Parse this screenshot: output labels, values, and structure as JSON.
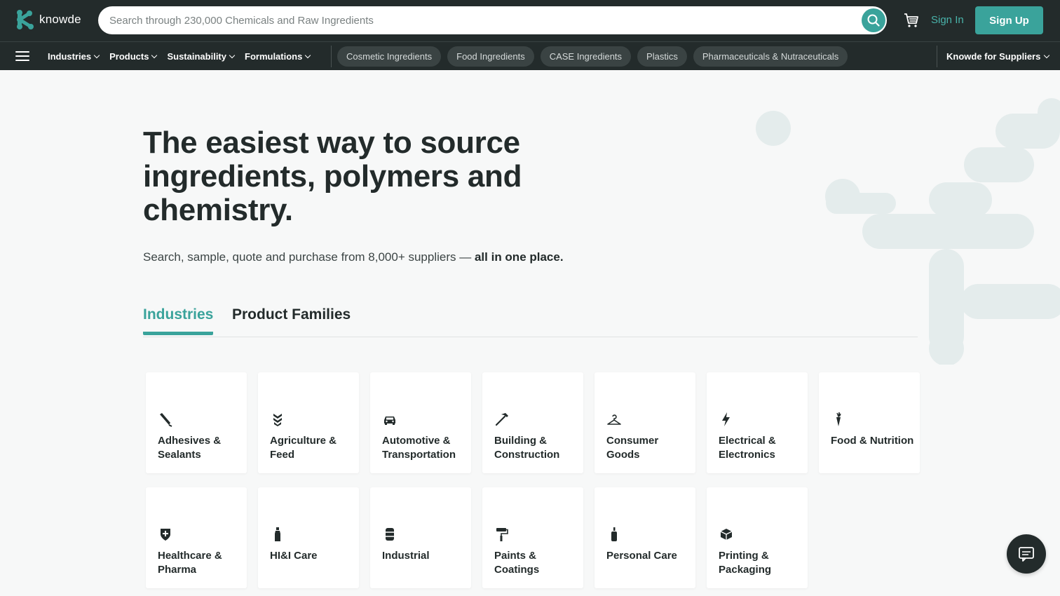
{
  "header": {
    "logo_text": "knowde",
    "search_placeholder": "Search through 230,000 Chemicals and Raw Ingredients",
    "sign_in": "Sign In",
    "sign_up": "Sign Up",
    "brand_color": "#3aa39b",
    "dark_color": "#232b2b"
  },
  "nav": {
    "menu": [
      "Industries",
      "Products",
      "Sustainability",
      "Formulations"
    ],
    "chips": [
      "Cosmetic Ingredients",
      "Food Ingredients",
      "CASE Ingredients",
      "Plastics",
      "Pharmaceuticals & Nutraceuticals"
    ],
    "suppliers": "Knowde for Suppliers"
  },
  "hero": {
    "title": "The easiest way to source ingredients, polymers and chemistry.",
    "subtitle": "Search, sample, quote and purchase from 8,000+ suppliers — ",
    "subtitle_bold": "all in one place."
  },
  "tabs": {
    "active": "Industries",
    "other": "Product Families"
  },
  "industries": [
    {
      "label": "Adhesives & Sealants",
      "icon": "adhesive-tube-icon"
    },
    {
      "label": "Agriculture & Feed",
      "icon": "wheat-icon"
    },
    {
      "label": "Automotive & Transportation",
      "icon": "car-icon"
    },
    {
      "label": "Building & Construction",
      "icon": "hammer-icon"
    },
    {
      "label": "Consumer Goods",
      "icon": "hanger-icon"
    },
    {
      "label": "Electrical & Electronics",
      "icon": "lightning-icon"
    },
    {
      "label": "Food & Nutrition",
      "icon": "carrot-icon"
    },
    {
      "label": "Healthcare & Pharma",
      "icon": "medical-shield-icon"
    },
    {
      "label": "HI&I Care",
      "icon": "spray-bottle-icon"
    },
    {
      "label": "Industrial",
      "icon": "barrel-icon"
    },
    {
      "label": "Paints & Coatings",
      "icon": "paint-roller-icon"
    },
    {
      "label": "Personal Care",
      "icon": "lotion-bottle-icon"
    },
    {
      "label": "Printing & Packaging",
      "icon": "package-icon"
    }
  ]
}
